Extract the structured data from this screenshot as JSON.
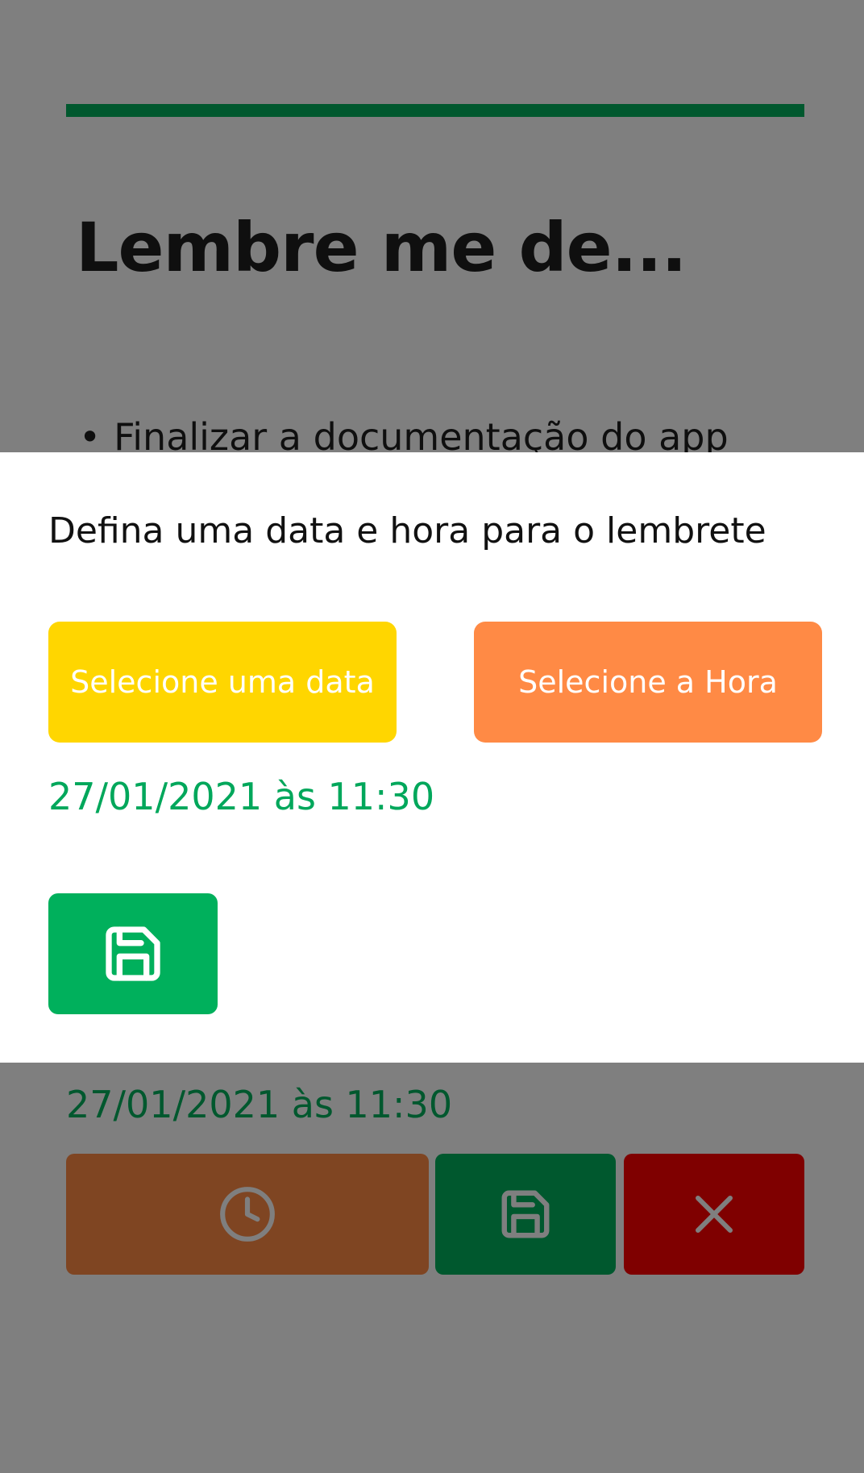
{
  "screen": {
    "title": "Lembre me de...",
    "reminder_item": "Finalizar a documentação do app",
    "datetime": "27/01/2021 às 11:30",
    "actions": {
      "time_icon": "clock-icon",
      "save_icon": "floppy-disk-icon",
      "delete_icon": "close-icon"
    }
  },
  "dialog": {
    "prompt": "Defina uma data e hora para o lembrete",
    "select_date_label": "Selecione uma data",
    "select_time_label": "Selecione a Hora",
    "selected_datetime": "27/01/2021 às 11:30",
    "save_icon": "floppy-disk-icon"
  },
  "colors": {
    "accent_green": "#00b05c",
    "date_button": "#ffd600",
    "time_button": "#ff8a45",
    "delete_button": "#ff0000",
    "scrim": "rgba(0,0,0,0.5)"
  }
}
